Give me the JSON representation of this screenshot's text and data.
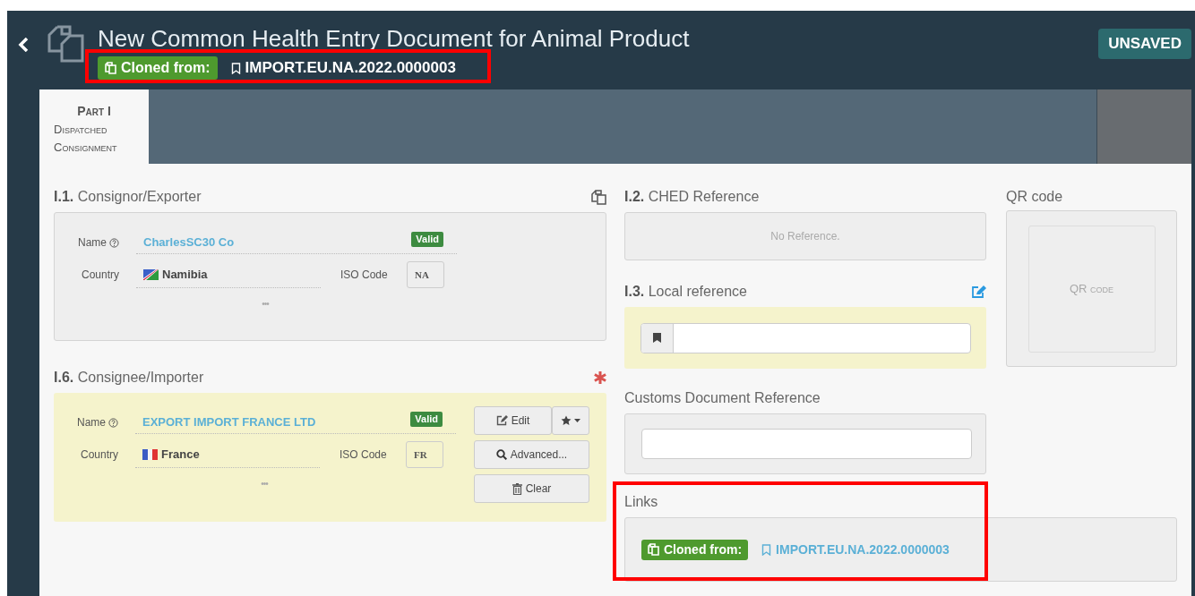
{
  "header": {
    "title": "New Common Health Entry Document for Animal Product",
    "cloned_label": "Cloned from:",
    "cloned_ref": "IMPORT.EU.NA.2022.0000003",
    "status": "UNSAVED"
  },
  "tabs": [
    {
      "title": "Part I",
      "subtitle": "Dispatched Consignment",
      "selected": true
    }
  ],
  "parties": [
    {
      "number": "I.1.",
      "title": "Consignor/Exporter",
      "highlighted": false,
      "required": false,
      "name_label": "Name",
      "name": "CharlesSC30 Co",
      "status": "Valid",
      "country_label": "Country",
      "kind": "namibia",
      "country": "Namibia",
      "iso_label": "ISO Code",
      "iso": "NA",
      "more": "•••"
    },
    {
      "number": "I.6.",
      "title": "Consignee/Importer",
      "highlighted": true,
      "required": true,
      "name_label": "Name",
      "name": "EXPORT IMPORT FRANCE LTD",
      "status": "Valid",
      "country_label": "Country",
      "kind": "france",
      "country": "France",
      "iso_label": "ISO Code",
      "iso": "FR",
      "more": "•••",
      "buttons": [
        {
          "kind": "edit",
          "label": "Edit"
        },
        {
          "kind": "advanced",
          "label": "Advanced..."
        },
        {
          "kind": "clear",
          "label": "Clear"
        }
      ]
    }
  ],
  "ched": {
    "number": "I.2.",
    "title": "CHED Reference",
    "empty_text": "No Reference."
  },
  "local_reference": {
    "number": "I.3.",
    "title": "Local reference"
  },
  "customs": {
    "title": "Customs Document Reference"
  },
  "qr": {
    "title": "QR code",
    "placeholder": "QR code"
  },
  "links": {
    "title": "Links",
    "cloned_label": "Cloned from:",
    "cloned_ref": "IMPORT.EU.NA.2022.0000003"
  }
}
